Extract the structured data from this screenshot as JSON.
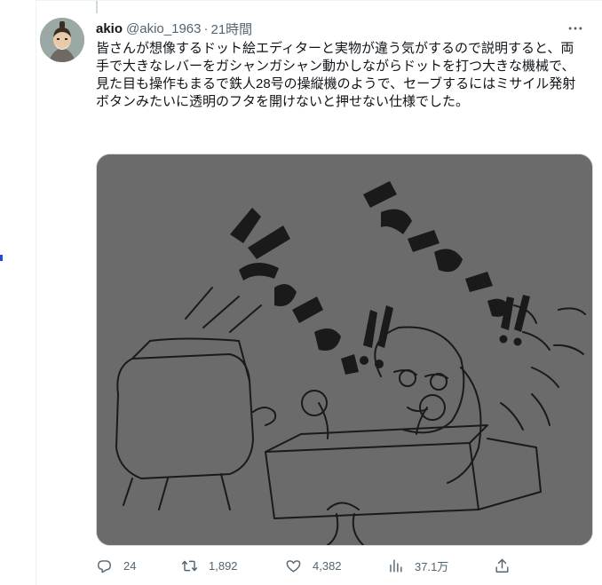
{
  "tweet": {
    "author_name": "akio",
    "handle": "@akio_1963",
    "separator": "·",
    "time": "21時間",
    "text": "皆さんが想像するドット絵エディターと実物が違う気がするので説明すると、両手で大きなレバーをガシャンガシャン動かしながらドットを打つ大きな機械で、見た目も操作もまるで鉄人28号の操縦機のようで、セーブするにはミサイル発射ボタンみたいに透明のフタを開けないと押せない仕様でした。",
    "more_icon": "more-icon"
  },
  "actions": {
    "replies": "24",
    "retweets": "1,892",
    "likes": "4,382",
    "views": "37.1万"
  },
  "icons": {
    "reply": "reply-icon",
    "retweet": "retweet-icon",
    "like": "heart-icon",
    "views": "views-icon",
    "share": "share-icon"
  },
  "colors": {
    "text": "#0f1419",
    "secondary": "#536471",
    "border": "#eff3f4",
    "media_bg": "#6b6b6b"
  }
}
